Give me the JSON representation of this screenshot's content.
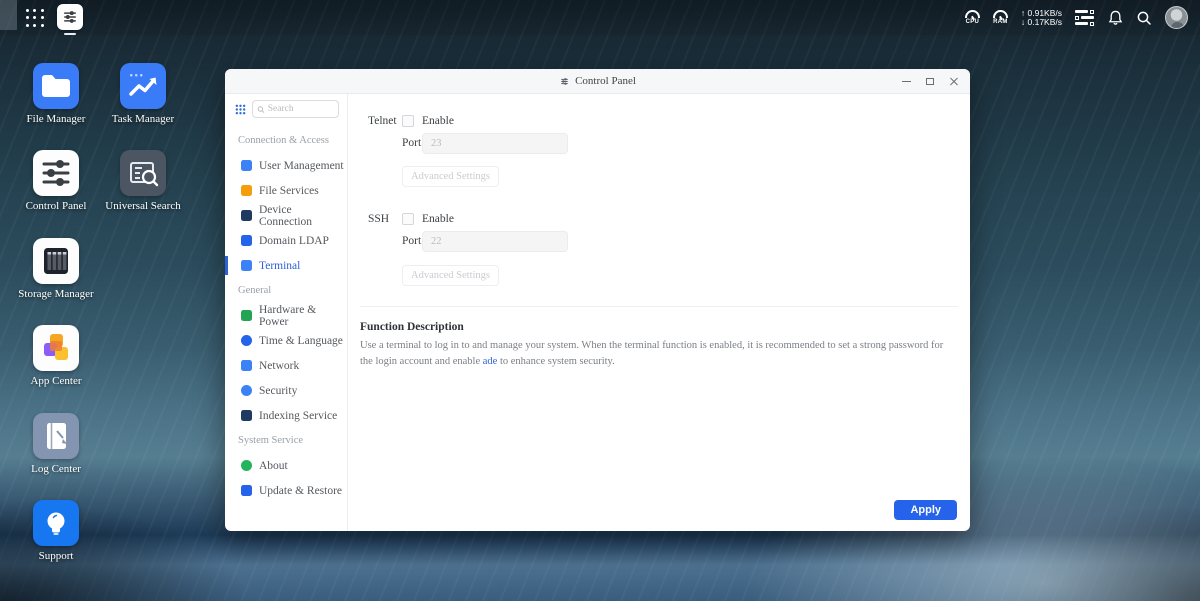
{
  "colors": {
    "accent_blue": "#2e62d9",
    "apply_button": "#2563eb",
    "window_bg": "#ffffff",
    "selected_item": "#2e62d9"
  },
  "topbar": {
    "cpu_label": "CPU",
    "ram_label": "RAM",
    "net_up": "↑ 0.91KB/s",
    "net_down": "↓ 0.17KB/s",
    "taskbar_app": "Control Panel"
  },
  "desktop": {
    "icons": [
      {
        "label": "File Manager",
        "icon": "folder-icon",
        "tile_color": "#3a7bf7"
      },
      {
        "label": "Task Manager",
        "icon": "trend-chart-icon",
        "tile_color": "#3a7bf7"
      },
      {
        "label": "Control Panel",
        "icon": "sliders-icon",
        "tile_color": "#fdfdfd"
      },
      {
        "label": "Universal Search",
        "icon": "list-search-icon",
        "tile_color": "#4c5663"
      },
      {
        "label": "Storage Manager",
        "icon": "disk-array-icon",
        "tile_color": "#fdfdfd"
      },
      {
        "label": "App Center",
        "icon": "app-squares-icon",
        "tile_color": "#fdfdfd"
      },
      {
        "label": "Log Center",
        "icon": "notebook-icon",
        "tile_color": "#8495b2"
      },
      {
        "label": "Support",
        "icon": "lightbulb-icon",
        "tile_color": "#1677f0"
      }
    ]
  },
  "window": {
    "title": "Control Panel",
    "sidebar": {
      "search_placeholder": "Search",
      "sections": [
        {
          "title": "Connection & Access",
          "items": [
            {
              "label": "User Management",
              "icon": "user-icon",
              "icon_color": "#3b82f6",
              "shape": "square"
            },
            {
              "label": "File Services",
              "icon": "folder-icon",
              "icon_color": "#f59e0b",
              "shape": "square"
            },
            {
              "label": "Device Connection",
              "icon": "device-icon",
              "icon_color": "#1e3a5f",
              "shape": "square"
            },
            {
              "label": "Domain LDAP",
              "icon": "domain-icon",
              "icon_color": "#2563eb",
              "shape": "square"
            },
            {
              "label": "Terminal",
              "icon": "terminal-icon",
              "icon_color": "#3b82f6",
              "shape": "square",
              "selected": true
            }
          ]
        },
        {
          "title": "General",
          "items": [
            {
              "label": "Hardware & Power",
              "icon": "chip-icon",
              "icon_color": "#22a454",
              "shape": "square"
            },
            {
              "label": "Time & Language",
              "icon": "globe-icon",
              "icon_color": "#2563eb",
              "shape": "circle"
            },
            {
              "label": "Network",
              "icon": "network-icon",
              "icon_color": "#3b82f6",
              "shape": "square"
            },
            {
              "label": "Security",
              "icon": "shield-icon",
              "icon_color": "#3b82f6",
              "shape": "circle"
            },
            {
              "label": "Indexing Service",
              "icon": "index-icon",
              "icon_color": "#1e3a5f",
              "shape": "square"
            }
          ]
        },
        {
          "title": "System Service",
          "items": [
            {
              "label": "About",
              "icon": "info-icon",
              "icon_color": "#22b45e",
              "shape": "circle"
            },
            {
              "label": "Update & Restore",
              "icon": "update-icon",
              "icon_color": "#2563eb",
              "shape": "square"
            }
          ]
        }
      ]
    },
    "main": {
      "telnet": {
        "label": "Telnet",
        "enable_label": "Enable",
        "port_label": "Port",
        "port_value": "23",
        "advanced_label": "Advanced Settings"
      },
      "ssh": {
        "label": "SSH",
        "enable_label": "Enable",
        "port_label": "Port",
        "port_value": "22",
        "advanced_label": "Advanced Settings"
      },
      "description": {
        "title": "Function Description",
        "text_before": "Use a terminal to log in to and manage your system. When the terminal function is enabled, it is recommended to set a strong password for the login account and enable ",
        "link_text": "ade",
        "text_after": " to enhance system security."
      },
      "apply_label": "Apply"
    }
  }
}
